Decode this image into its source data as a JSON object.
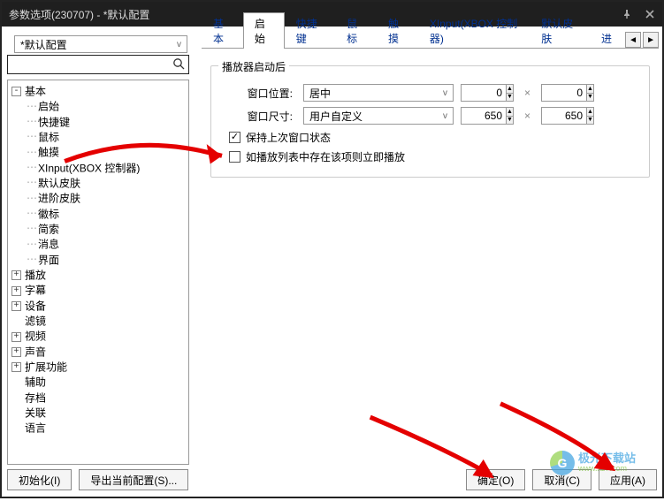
{
  "window_title": "参数选项(230707) - *默认配置",
  "profile_selected": "*默认配置",
  "search_placeholder": "",
  "tabs": {
    "items": [
      "基本",
      "启始",
      "快捷键",
      "鼠标",
      "触摸",
      "XInput(XBOX 控制器)",
      "默认皮肤",
      "进"
    ],
    "active_index": 1
  },
  "tree": [
    {
      "label": "基本",
      "depth": 0,
      "expander": "-"
    },
    {
      "label": "启始",
      "depth": 1
    },
    {
      "label": "快捷键",
      "depth": 1
    },
    {
      "label": "鼠标",
      "depth": 1
    },
    {
      "label": "触摸",
      "depth": 1
    },
    {
      "label": "XInput(XBOX 控制器)",
      "depth": 1
    },
    {
      "label": "默认皮肤",
      "depth": 1
    },
    {
      "label": "进阶皮肤",
      "depth": 1
    },
    {
      "label": "徽标",
      "depth": 1
    },
    {
      "label": "简索",
      "depth": 1
    },
    {
      "label": "消息",
      "depth": 1
    },
    {
      "label": "界面",
      "depth": 1
    },
    {
      "label": "播放",
      "depth": 0,
      "expander": "+"
    },
    {
      "label": "字幕",
      "depth": 0,
      "expander": "+"
    },
    {
      "label": "设备",
      "depth": 0,
      "expander": "+"
    },
    {
      "label": "滤镜",
      "depth": 0
    },
    {
      "label": "视频",
      "depth": 0,
      "expander": "+"
    },
    {
      "label": "声音",
      "depth": 0,
      "expander": "+"
    },
    {
      "label": "扩展功能",
      "depth": 0,
      "expander": "+"
    },
    {
      "label": "辅助",
      "depth": 0
    },
    {
      "label": "存档",
      "depth": 0
    },
    {
      "label": "关联",
      "depth": 0
    },
    {
      "label": "语言",
      "depth": 0
    }
  ],
  "group": {
    "title": "播放器启动后",
    "row_pos_label": "窗口位置:",
    "pos_select": "居中",
    "pos_x": "0",
    "pos_y": "0",
    "row_size_label": "窗口尺寸:",
    "size_select": "用户自定义",
    "size_w": "650",
    "size_h": "650",
    "check1_label": "保持上次窗口状态",
    "check1_checked": true,
    "check2_label": "如播放列表中存在该项则立即播放",
    "check2_checked": false
  },
  "bottom": {
    "init": "初始化(I)",
    "export": "导出当前配置(S)...",
    "ok": "确定(O)",
    "cancel": "取消(C)",
    "apply": "应用(A)"
  },
  "watermark": {
    "cn": "极光下载站",
    "url": "www.xz7.com"
  }
}
